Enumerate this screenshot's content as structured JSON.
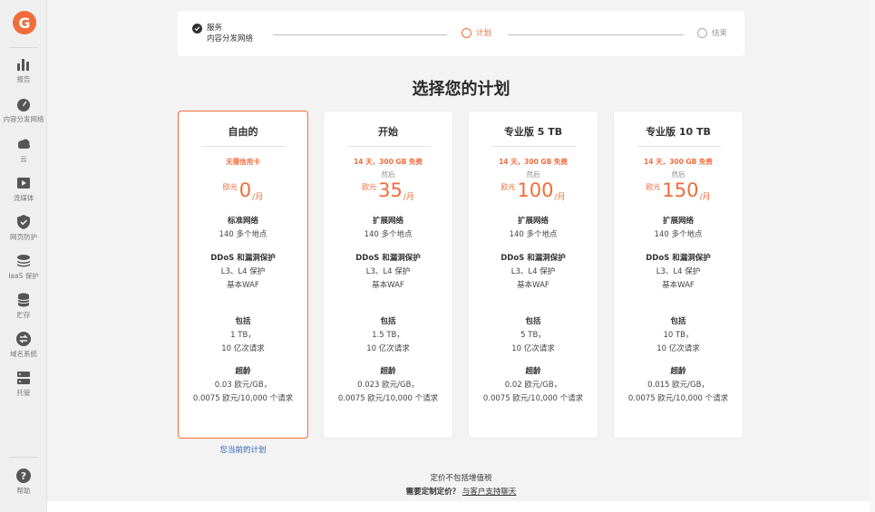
{
  "sidebar": {
    "logo_letter": "G",
    "items": [
      {
        "label": "报告",
        "icon": "bar-chart-icon"
      },
      {
        "label": "内容分发网络",
        "icon": "speedometer-icon"
      },
      {
        "label": "云",
        "icon": "cloud-icon"
      },
      {
        "label": "流媒体",
        "icon": "play-icon"
      },
      {
        "label": "网页防护",
        "icon": "shield-icon"
      },
      {
        "label": "IaaS 保护",
        "icon": "layers-icon"
      },
      {
        "label": "贮存",
        "icon": "database-icon"
      },
      {
        "label": "域名系统",
        "icon": "swap-icon"
      },
      {
        "label": "托管",
        "icon": "server-icon"
      }
    ],
    "help": {
      "label": "帮助",
      "icon": "question-icon"
    }
  },
  "stepper": {
    "step1_title": "服务",
    "step1_sub": "内容分发网络",
    "step2": "计划",
    "step3": "结束"
  },
  "page_title": "选择您的计划",
  "plans": [
    {
      "name": "自由的",
      "offer": "无需信用卡",
      "then": "",
      "currency": "欧元",
      "amount": "0",
      "unit": "/月",
      "net_title": "标准网络",
      "net_sub": "140 多个地点",
      "ddos_title": "DDoS 和漏洞保护",
      "ddos_l1": "L3、L4 保护",
      "ddos_l2": "基本WAF",
      "inc_title": "包括",
      "inc_l1": "1 TB，",
      "inc_l2": "10 亿次请求",
      "over_title": "超龄",
      "over_l1": "0.03 欧元/GB，",
      "over_l2": "0.0075 欧元/10,000 个请求"
    },
    {
      "name": "开始",
      "offer": "14 天，300 GB 免费",
      "then": "然后",
      "currency": "欧元",
      "amount": "35",
      "unit": "/月",
      "net_title": "扩展网络",
      "net_sub": "140 多个地点",
      "ddos_title": "DDoS 和漏洞保护",
      "ddos_l1": "L3、L4 保护",
      "ddos_l2": "基本WAF",
      "inc_title": "包括",
      "inc_l1": "1.5 TB，",
      "inc_l2": "10 亿次请求",
      "over_title": "超龄",
      "over_l1": "0.023 欧元/GB，",
      "over_l2": "0.0075 欧元/10,000 个请求"
    },
    {
      "name": "专业版 5 TB",
      "offer": "14 天，300 GB 免费",
      "then": "然后",
      "currency": "欧元",
      "amount": "100",
      "unit": "/月",
      "net_title": "扩展网络",
      "net_sub": "140 多个地点",
      "ddos_title": "DDoS 和漏洞保护",
      "ddos_l1": "L3、L4 保护",
      "ddos_l2": "基本WAF",
      "inc_title": "包括",
      "inc_l1": "5 TB，",
      "inc_l2": "10 亿次请求",
      "over_title": "超龄",
      "over_l1": "0.02 欧元/GB，",
      "over_l2": "0.0075 欧元/10,000 个请求"
    },
    {
      "name": "专业版 10 TB",
      "offer": "14 天，300 GB 免费",
      "then": "然后",
      "currency": "欧元",
      "amount": "150",
      "unit": "/月",
      "net_title": "扩展网络",
      "net_sub": "140 多个地点",
      "ddos_title": "DDoS 和漏洞保护",
      "ddos_l1": "L3、L4 保护",
      "ddos_l2": "基本WAF",
      "inc_title": "包括",
      "inc_l1": "10 TB，",
      "inc_l2": "10 亿次请求",
      "over_title": "超龄",
      "over_l1": "0.015 欧元/GB，",
      "over_l2": "0.0075 欧元/10,000 个请求"
    }
  ],
  "current_plan": "您当前的计划",
  "footer": {
    "tax_note": "定价不包括增值税",
    "question": "需要定制定价？",
    "chat_link": "与客户支持聊天"
  },
  "colors": {
    "accent": "#f26b3a",
    "link": "#2f64b7"
  }
}
